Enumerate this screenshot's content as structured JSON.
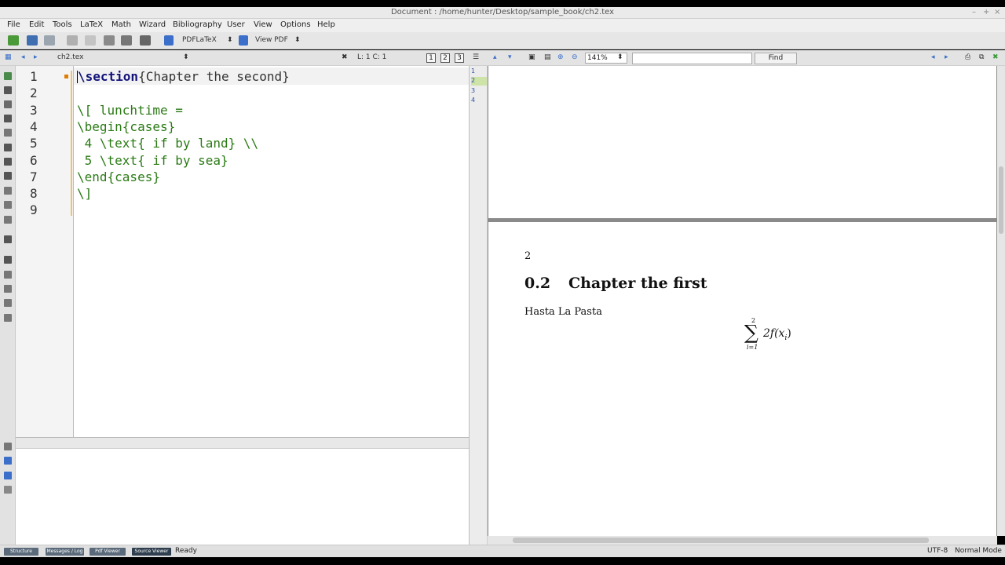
{
  "window": {
    "title": "Document : /home/hunter/Desktop/sample_book/ch2.tex",
    "controls": [
      "–",
      "+",
      "×"
    ]
  },
  "menu": [
    "File",
    "Edit",
    "Tools",
    "LaTeX",
    "Math",
    "Wizard",
    "Bibliography",
    "User",
    "View",
    "Options",
    "Help"
  ],
  "toolbar": {
    "compiler": "PDFLaTeX",
    "view_pdf": "View PDF"
  },
  "editor_header": {
    "filename": "ch2.tex",
    "cursor_position": "L: 1 C: 1",
    "view_buttons": [
      "1",
      "2",
      "3"
    ]
  },
  "editor": {
    "line_numbers": [
      "1",
      "2",
      "3",
      "4",
      "5",
      "6",
      "7",
      "8",
      "9"
    ],
    "line1_command": "\\section",
    "line1_rest": "{Chapter the second}",
    "line3": "\\[ lunchtime =",
    "line4": "\\begin{cases}",
    "line5": " 4 \\text{ if by land} \\\\",
    "line6": " 5 \\text{ if by sea}",
    "line7": "\\end{cases}",
    "line8": "\\]"
  },
  "pdf_header": {
    "zoom": "141%",
    "find_placeholder": "",
    "find_label": "Find"
  },
  "pdf_pages": [
    "1",
    "2",
    "3",
    "4"
  ],
  "pdf_content": {
    "page_number": "2",
    "section_number": "0.2",
    "section_title": "Chapter the first",
    "body_text": "Hasta La Pasta",
    "math_upper": "2",
    "math_sigma": "∑",
    "math_expression": "2f(x",
    "math_subscript": "i",
    "math_close": ")",
    "math_lower": "i=1"
  },
  "status": {
    "tabs": [
      "Structure",
      "Messages / Log",
      "Pdf Viewer",
      "Source Viewer"
    ],
    "active_tab": "Source Viewer",
    "message": "Ready",
    "encoding": "UTF-8",
    "mode": "Normal Mode"
  },
  "colors": {
    "keyword": "#12127a",
    "latex_text": "#2a7a14",
    "bookmark": "#e07a00",
    "selected_page": "#cde3a7"
  }
}
